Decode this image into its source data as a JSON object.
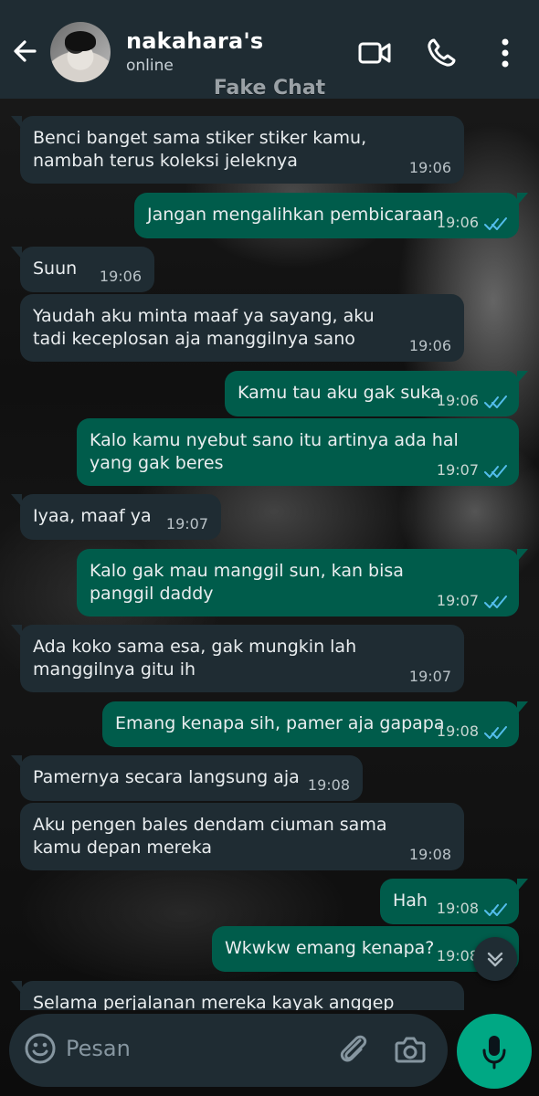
{
  "colors": {
    "header_bg": "#1f2c33",
    "incoming_bubble": "#1f2c33",
    "outgoing_bubble": "#005c4b",
    "read_ticks": "#53bdeb",
    "mic_button": "#00a884"
  },
  "header": {
    "contact_name": "nakahara's",
    "status": "online",
    "icons": [
      "back-arrow-icon",
      "video-call-icon",
      "voice-call-icon",
      "more-vertical-icon"
    ]
  },
  "watermark": "Fake Chat",
  "messages": [
    {
      "dir": "in",
      "text": "Benci banget sama stiker stiker kamu, nambah terus koleksi jeleknya",
      "time": "19:06"
    },
    {
      "dir": "out",
      "text": "Jangan mengalihkan pembicaraan",
      "time": "19:06",
      "read": true
    },
    {
      "dir": "in",
      "text": "Suun",
      "time": "19:06"
    },
    {
      "dir": "in",
      "text": "Yaudah aku minta maaf ya sayang, aku tadi keceplosan aja manggilnya sano",
      "time": "19:06"
    },
    {
      "dir": "out",
      "text": "Kamu tau aku gak suka",
      "time": "19:06",
      "read": true
    },
    {
      "dir": "out",
      "text": "Kalo kamu nyebut sano itu artinya ada hal yang gak beres",
      "time": "19:07",
      "read": true
    },
    {
      "dir": "in",
      "text": "Iyaa, maaf ya",
      "time": "19:07"
    },
    {
      "dir": "out",
      "text": "Kalo gak mau manggil sun, kan bisa panggil daddy",
      "time": "19:07",
      "read": true
    },
    {
      "dir": "in",
      "text": "Ada koko sama esa, gak mungkin lah manggilnya gitu ih",
      "time": "19:07"
    },
    {
      "dir": "out",
      "text": "Emang kenapa sih, pamer aja gapapa",
      "time": "19:08",
      "read": true
    },
    {
      "dir": "in",
      "text": "Pamernya secara langsung aja",
      "time": "19:08"
    },
    {
      "dir": "in",
      "text": "Aku pengen bales dendam ciuman sama kamu depan mereka",
      "time": "19:08"
    },
    {
      "dir": "out",
      "text": "Hah",
      "time": "19:08",
      "read": true
    },
    {
      "dir": "out",
      "text": "Wkwkw emang kenapa?",
      "time": "19:08",
      "read": true
    },
    {
      "dir": "in",
      "text": "Selama perjalanan mereka kayak anggep aku",
      "time": ""
    }
  ],
  "composer": {
    "placeholder": "Pesan",
    "icons": [
      "emoji-icon",
      "attach-icon",
      "camera-icon",
      "mic-icon"
    ]
  },
  "scroll_button_icon": "double-chevron-down-icon"
}
